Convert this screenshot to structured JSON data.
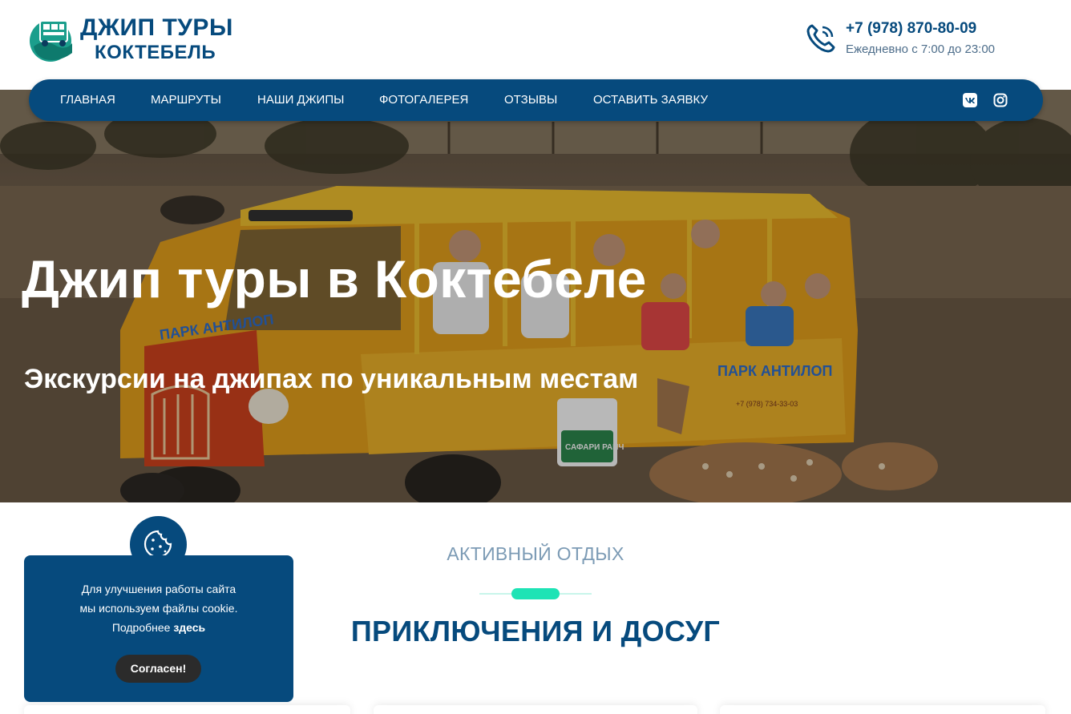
{
  "header": {
    "logo": {
      "line1": "ДЖИП ТУРЫ",
      "line2": "КОКТЕБЕЛЬ",
      "icon": "jeep-logo-icon"
    },
    "phone": {
      "number": "+7 (978) 870-80-09",
      "hours": "Ежедневно с 7:00 до 23:00",
      "icon": "phone-icon"
    }
  },
  "nav": {
    "items": [
      {
        "label": "ГЛАВНАЯ"
      },
      {
        "label": "МАРШРУТЫ"
      },
      {
        "label": "НАШИ ДЖИПЫ"
      },
      {
        "label": "ФОТОГАЛЕРЕЯ"
      },
      {
        "label": "ОТЗЫВЫ"
      },
      {
        "label": "ОСТАВИТЬ ЗАЯВКУ"
      }
    ],
    "social": [
      {
        "icon": "vk-icon"
      },
      {
        "icon": "instagram-icon"
      }
    ]
  },
  "hero": {
    "title": "Джип туры в Коктебеле",
    "subtitle": "Экскурсии на джипах по уникальным местам",
    "vehicle_texts": [
      "ПАРК АНТИЛОП",
      "ПАРК АНТИЛОП",
      "+7 (978) 734-33-03",
      "САФАРИ РАНЧ"
    ]
  },
  "section": {
    "eyebrow": "АКТИВНЫЙ ОТДЫХ",
    "title": "ПРИКЛЮЧЕНИЯ И ДОСУГ"
  },
  "cookie": {
    "line1": "Для улучшения работы сайта",
    "line2": "мы используем файлы cookie.",
    "line3_prefix": "Подробнее",
    "link": "здесь",
    "button": "Согласен!",
    "icon": "cookie-icon"
  },
  "colors": {
    "brand": "#064a7d",
    "accent": "#1de3b5",
    "muted": "#7c9bb5",
    "button_dark": "#2b2b2b"
  }
}
